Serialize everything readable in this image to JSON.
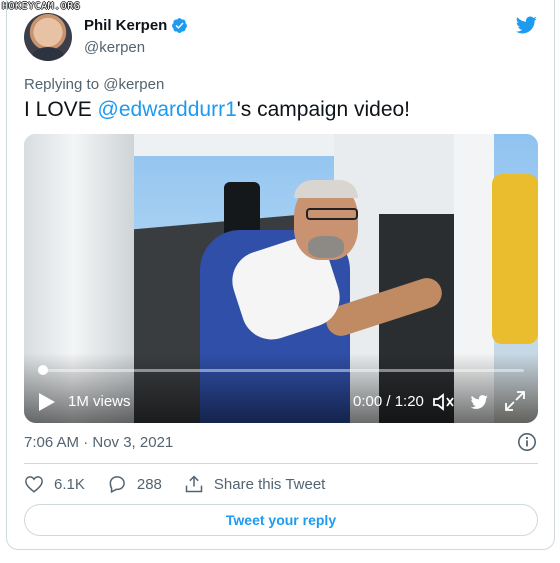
{
  "watermark": "HOKEYCAM.ORG",
  "author": {
    "name": "Phil Kerpen",
    "handle": "@kerpen"
  },
  "reply_to": {
    "prefix": "Replying to",
    "handle": "@kerpen"
  },
  "tweet": {
    "text_prefix": "I LOVE ",
    "mention": "@edwarddurr1",
    "text_suffix": "'s campaign video!"
  },
  "video": {
    "views": "1M views",
    "time": "0:00 / 1:20",
    "progress": 0.0
  },
  "timestamp": "7:06 AM · Nov 3, 2021",
  "actions": {
    "likes": "6.1K",
    "replies": "288",
    "share_label": "Share this Tweet"
  },
  "reply_button": "Tweet your reply",
  "colors": {
    "accent": "#1d9bf0",
    "secondary_text": "#536471",
    "border": "#cfd9de"
  },
  "icons": [
    "verified-badge-icon",
    "twitter-bird-icon",
    "play-icon",
    "volume-icon",
    "expand-icon",
    "info-icon",
    "heart-icon",
    "reply-icon",
    "share-icon"
  ]
}
